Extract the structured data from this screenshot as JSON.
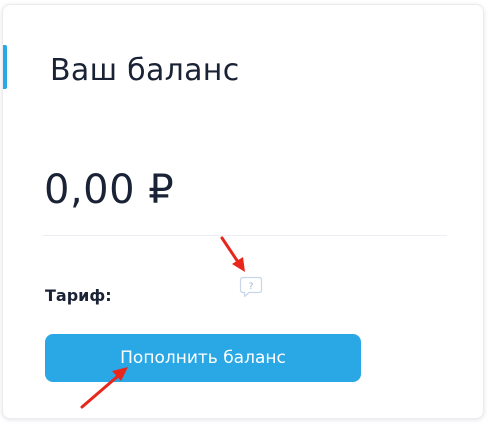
{
  "balance_card": {
    "title": "Ваш баланс",
    "amount": "0,00 ₽",
    "tariff_label": "Тариф:",
    "help_icon": "question-bubble-icon",
    "topup_button_label": "Пополнить баланс"
  },
  "annotations": {
    "arrow_color": "#e8261b",
    "arrows": [
      "arrow-to-help-icon",
      "arrow-to-topup-button"
    ]
  },
  "colors": {
    "accent": "#2aa8e6",
    "text": "#1a2336",
    "button_text": "#ffffff"
  }
}
